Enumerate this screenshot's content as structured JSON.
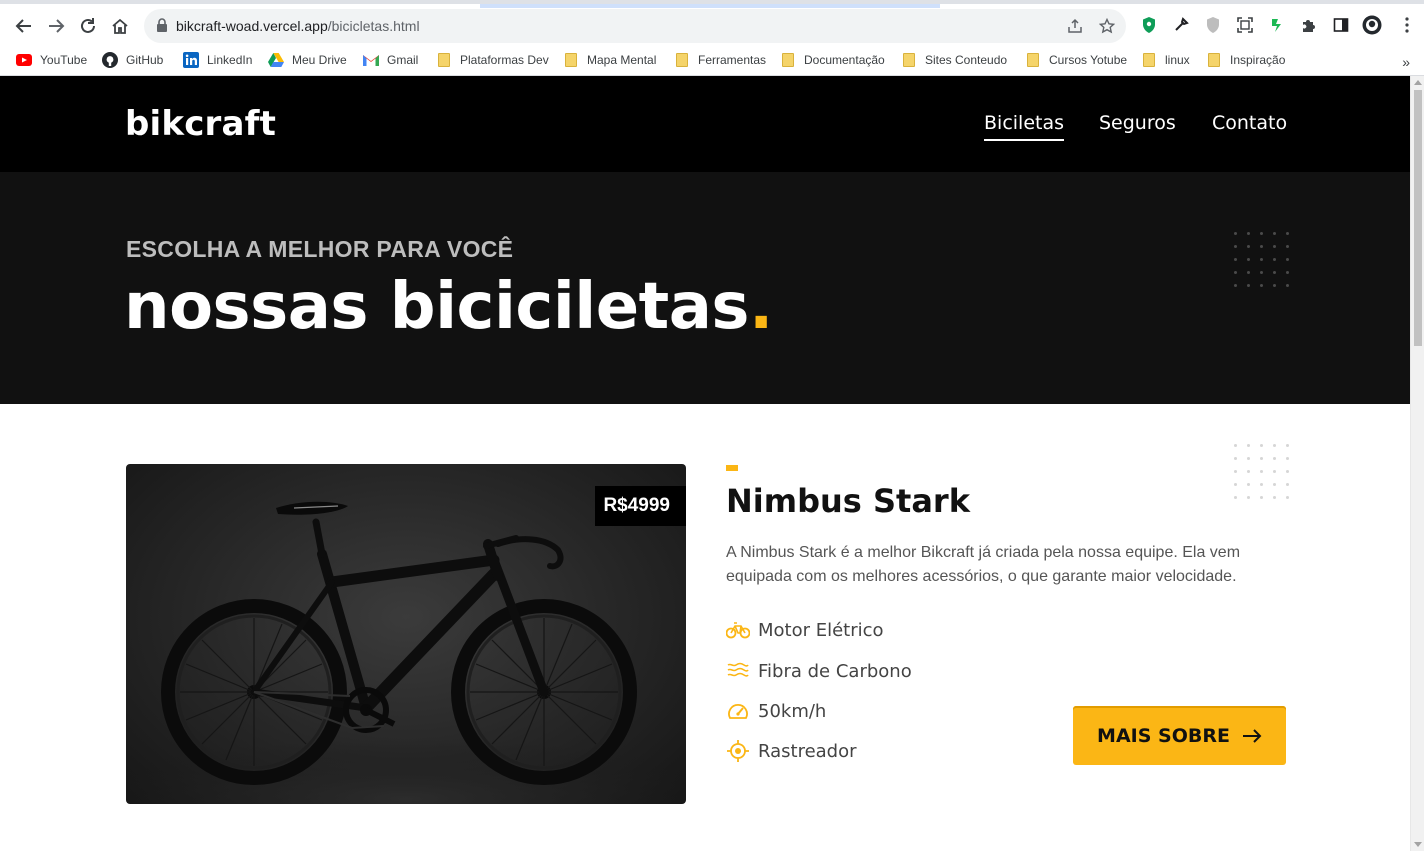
{
  "browser": {
    "url_host": "bikcraft-woad.vercel.app",
    "url_path": "/bicicletas.html",
    "bookmarks": [
      {
        "label": "YouTube",
        "icon": "youtube-icon"
      },
      {
        "label": "GitHub",
        "icon": "github-icon"
      },
      {
        "label": "LinkedIn",
        "icon": "linkedin-icon"
      },
      {
        "label": "Meu Drive",
        "icon": "google-drive-icon"
      },
      {
        "label": "Gmail",
        "icon": "gmail-icon"
      },
      {
        "label": "Plataformas Dev",
        "icon": "folder-icon"
      },
      {
        "label": "Mapa Mental",
        "icon": "folder-icon"
      },
      {
        "label": "Ferramentas",
        "icon": "folder-icon"
      },
      {
        "label": "Documentação",
        "icon": "folder-icon"
      },
      {
        "label": "Sites Conteudo",
        "icon": "folder-icon"
      },
      {
        "label": "Cursos Yotube",
        "icon": "folder-icon"
      },
      {
        "label": "linux",
        "icon": "folder-icon"
      },
      {
        "label": "Inspiração",
        "icon": "folder-icon"
      }
    ],
    "bookmarks_more": "»"
  },
  "site": {
    "logo": "bikcraft",
    "menu": [
      {
        "label": "Biciletas",
        "active": true
      },
      {
        "label": "Seguros",
        "active": false
      },
      {
        "label": "Contato",
        "active": false
      }
    ]
  },
  "hero": {
    "subtitle": "ESCOLHA A MELHOR PARA VOCÊ",
    "title": "nossas biciciletas",
    "title_dot": "."
  },
  "product": {
    "price": "R$4999",
    "name": "Nimbus Stark",
    "description": "A Nimbus Stark é a melhor Bikcraft já criada pela nossa equipe. Ela vem equipada com os melhores acessórios, o que garante maior velocidade.",
    "features": [
      {
        "label": "Motor Elétrico",
        "icon": "electric-bike-icon"
      },
      {
        "label": "Fibra de Carbono",
        "icon": "carbon-fiber-icon"
      },
      {
        "label": "50km/h",
        "icon": "speedometer-icon"
      },
      {
        "label": "Rastreador",
        "icon": "tracker-icon"
      }
    ],
    "cta_label": "MAIS SOBRE"
  },
  "colors": {
    "accent": "#fbb615",
    "header_bg": "#000000",
    "hero_bg": "#111111"
  }
}
